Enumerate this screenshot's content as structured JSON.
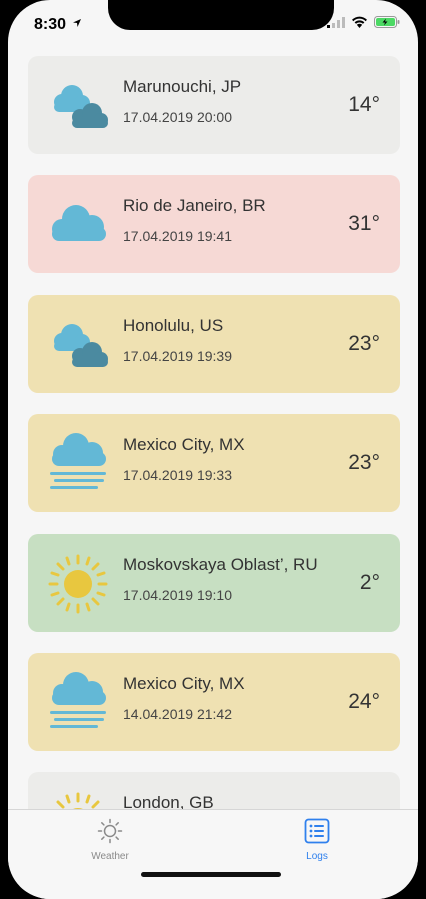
{
  "status_bar": {
    "time": "8:30"
  },
  "colors": {
    "gray_card": "#ececea",
    "pink_card": "#f6d9d5",
    "yellow_card": "#efe1b2",
    "green_card": "#c7dfc2",
    "accent": "#2f80ed",
    "cloud_light": "#63b8d6",
    "cloud_dark": "#4b8aa0",
    "sun": "#e8c73f"
  },
  "logs": [
    {
      "city": "Marunouchi, JP",
      "date": "17.04.2019 20:00",
      "temp": "14°",
      "icon": "partly-cloudy-icon",
      "color": "#ececea"
    },
    {
      "city": "Rio de Janeiro, BR",
      "date": "17.04.2019 19:41",
      "temp": "31°",
      "icon": "cloud-icon",
      "color": "#f6d9d5"
    },
    {
      "city": "Honolulu, US",
      "date": "17.04.2019 19:39",
      "temp": "23°",
      "icon": "partly-cloudy-icon",
      "color": "#efe1b2"
    },
    {
      "city": "Mexico City, MX",
      "date": "17.04.2019 19:33",
      "temp": "23°",
      "icon": "fog-icon",
      "color": "#efe1b2"
    },
    {
      "city": "Moskovskaya Oblast’, RU",
      "date": "17.04.2019 19:10",
      "temp": "2°",
      "icon": "sun-icon",
      "color": "#c7dfc2"
    },
    {
      "city": "Mexico City, MX",
      "date": "14.04.2019 21:42",
      "temp": "24°",
      "icon": "fog-icon",
      "color": "#efe1b2"
    },
    {
      "city": "London, GB",
      "date": "",
      "temp": "",
      "icon": "sun-icon",
      "color": "#ececea"
    }
  ],
  "tabs": [
    {
      "label": "Weather",
      "icon": "sun-outline-icon",
      "active": false
    },
    {
      "label": "Logs",
      "icon": "list-icon",
      "active": true
    }
  ]
}
